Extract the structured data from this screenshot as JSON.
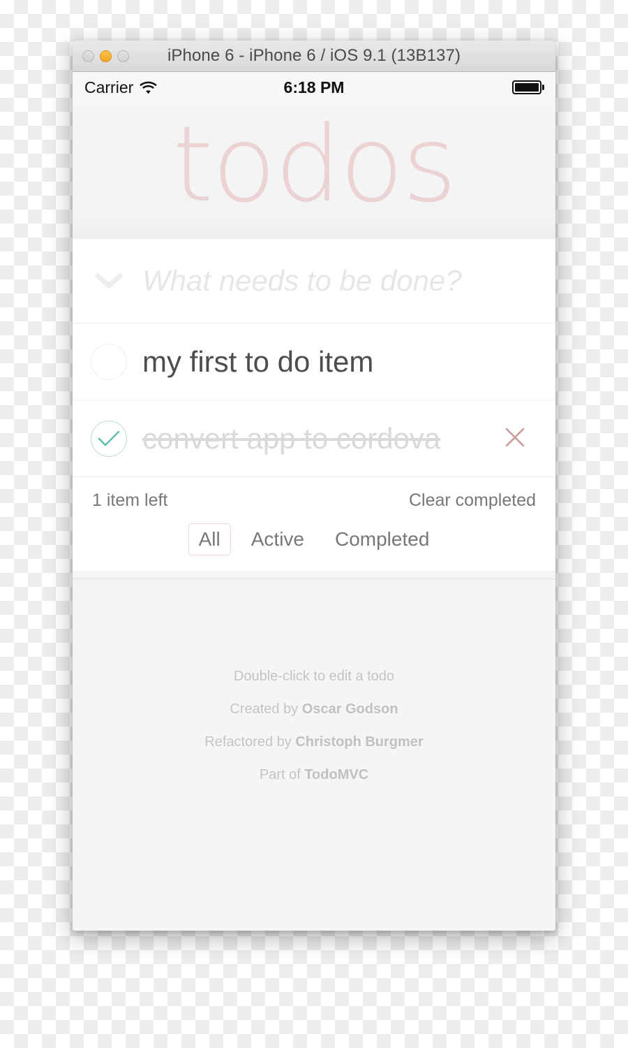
{
  "window": {
    "title": "iPhone 6 - iPhone 6 / iOS 9.1 (13B137)",
    "traffic_lights": [
      {
        "name": "close-button",
        "state": "inactive"
      },
      {
        "name": "minimize-button",
        "state": "amber"
      },
      {
        "name": "zoom-button",
        "state": "inactive"
      }
    ]
  },
  "status_bar": {
    "carrier": "Carrier",
    "wifi_icon": "wifi-icon",
    "time": "6:18 PM",
    "battery_icon": "battery-full-icon"
  },
  "app": {
    "brand": "todos",
    "new_todo": {
      "value": "",
      "placeholder": "What needs to be done?"
    },
    "toggle_all_icon": "chevron-down-icon",
    "todos": [
      {
        "title": "my first to do item",
        "completed": false,
        "toggle_icon": "circle-empty-icon"
      },
      {
        "title": "convert app to cordova",
        "completed": true,
        "toggle_icon": "circle-check-icon",
        "destroy_icon": "close-x-icon",
        "destroy_label": "×"
      }
    ],
    "footer": {
      "count_text": "1 item left",
      "clear_completed": "Clear completed",
      "filters": [
        {
          "label": "All",
          "selected": true
        },
        {
          "label": "Active",
          "selected": false
        },
        {
          "label": "Completed",
          "selected": false
        }
      ]
    },
    "info": {
      "line1": "Double-click to edit a todo",
      "line2_prefix": "Created by ",
      "line2_name": "Oscar Godson",
      "line3_prefix": "Refactored by ",
      "line3_name": "Christoph Burgmer",
      "line4_prefix": "Part of ",
      "line4_name": "TodoMVC"
    }
  },
  "colors": {
    "brand_pink": "#ebd3d3",
    "check_green": "#5dc2af",
    "destroy_red": "#cc9a9a",
    "filter_border": "#f3d6d6",
    "titlebar_amber": "#f4a81f"
  }
}
